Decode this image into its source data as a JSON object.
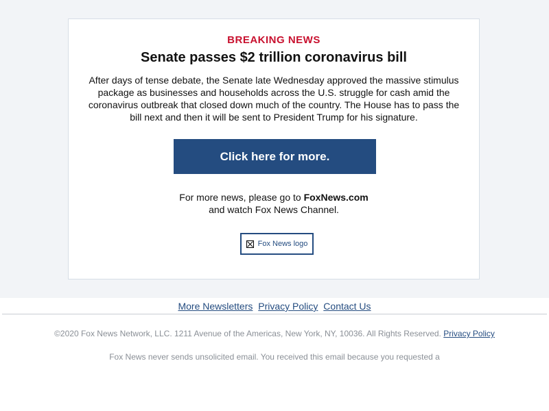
{
  "card": {
    "kicker": "BREAKING NEWS",
    "headline": "Senate passes $2 trillion coronavirus bill",
    "body": "After days of tense debate, the Senate late Wednesday approved the massive stimulus package as businesses and households across the U.S. struggle for cash amid the coronavirus outbreak that closed down much of the country. The House has to pass the bill next and then it will be sent to President Trump for his signature.",
    "cta_label": "Click here for more.",
    "more_news_prefix": "For more news, please go to",
    "more_news_site": "FoxNews.com",
    "more_news_suffix": "and watch Fox News Channel.",
    "logo_alt": "Fox News logo"
  },
  "footer": {
    "links": [
      "More Newsletters",
      "Privacy Policy",
      "Contact Us"
    ],
    "copyright": "©2020 Fox News Network, LLC. 1211 Avenue of the Americas, New York, NY, 10036. All Rights Reserved.",
    "copyright_link": "Privacy Policy",
    "disclaimer": "Fox News never sends unsolicited email. You received this email because you requested a"
  },
  "colors": {
    "accent": "#c8102e",
    "brand": "#244c80",
    "page_band": "#f2f4f7",
    "muted_text": "#8a8f96"
  },
  "icons": {
    "logo": "broken-image-icon"
  }
}
